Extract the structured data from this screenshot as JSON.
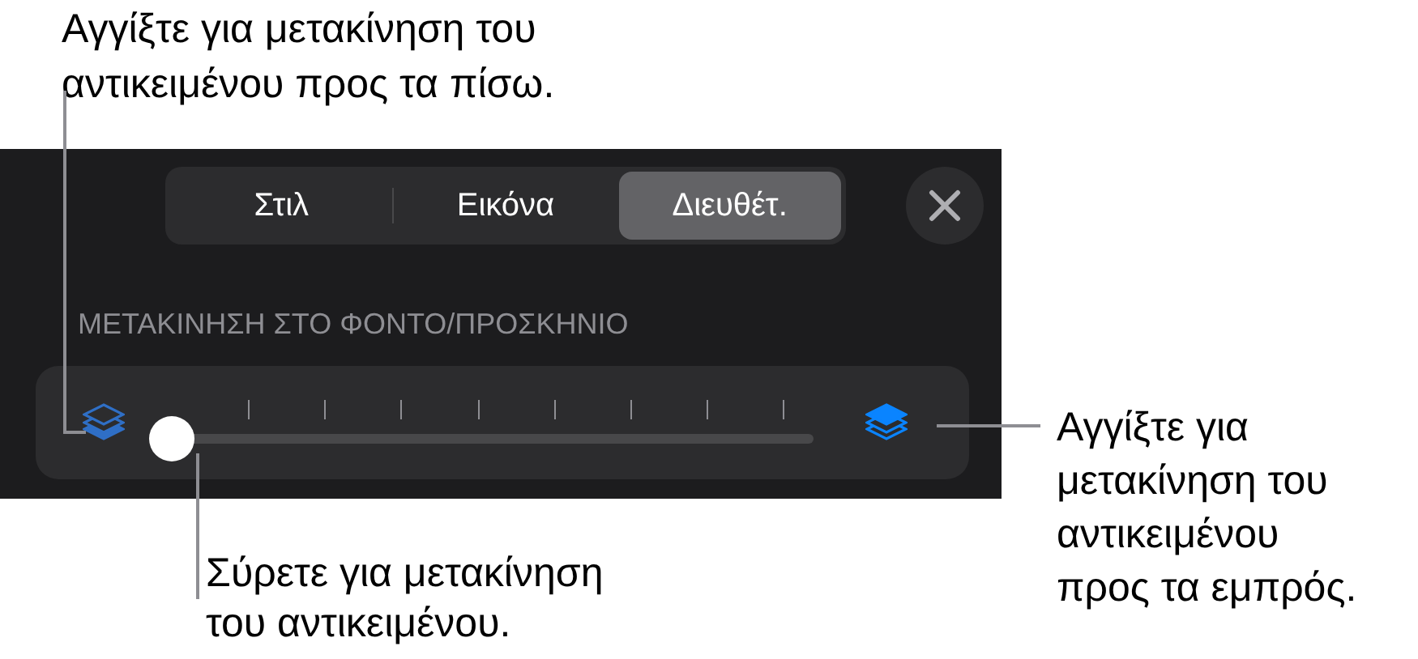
{
  "callouts": [
    {
      "text": "Αγγίξτε για μετακίνηση του αντικειμένου προς τα πίσω."
    },
    {
      "text": "Αγγίξτε για μετακίνηση του αντικειμένου προς τα εμπρός."
    },
    {
      "text": "Σύρετε για μετακίνηση του αντικειμένου."
    }
  ],
  "tabs": [
    {
      "label": "Στιλ",
      "selected": false
    },
    {
      "label": "Εικόνα",
      "selected": false
    },
    {
      "label": "Διευθέτ.",
      "selected": true
    }
  ],
  "section_label": "ΜΕΤΑΚΙΝΗΣΗ ΣΤΟ ΦΟΝΤΟ/ΠΡΟΣΚΗΝΙΟ",
  "slider": {
    "level": 0
  }
}
